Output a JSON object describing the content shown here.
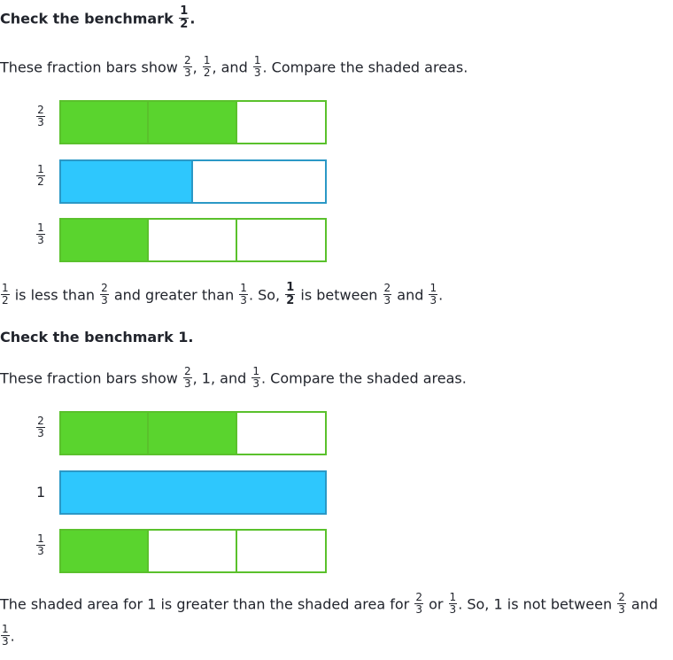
{
  "section1": {
    "heading_text": "Check the benchmark",
    "heading_frac": {
      "num": "1",
      "den": "2"
    },
    "intro": {
      "prefix": "These fraction bars show",
      "f1": {
        "num": "2",
        "den": "3"
      },
      "f2": {
        "num": "1",
        "den": "2"
      },
      "and": ", and",
      "f3": {
        "num": "1",
        "den": "3"
      },
      "suffix": ". Compare the shaded areas."
    },
    "bars": [
      {
        "label": {
          "num": "2",
          "den": "3"
        },
        "segments": 3,
        "filled": 2,
        "color": "#5ad42e"
      },
      {
        "label": {
          "num": "1",
          "den": "2"
        },
        "segments": 2,
        "filled": 1,
        "color": "#2ec7fd"
      },
      {
        "label": {
          "num": "1",
          "den": "3"
        },
        "segments": 3,
        "filled": 1,
        "color": "#5ad42e"
      }
    ],
    "conclusion": {
      "f_a": {
        "num": "1",
        "den": "2"
      },
      "t1": "is less than",
      "f_b": {
        "num": "2",
        "den": "3"
      },
      "t2": "and greater than",
      "f_c": {
        "num": "1",
        "den": "3"
      },
      "t3": ". So,",
      "f_d": {
        "num": "1",
        "den": "2"
      },
      "t4": "is between",
      "f_e": {
        "num": "2",
        "den": "3"
      },
      "t5": "and",
      "f_f": {
        "num": "1",
        "den": "3"
      },
      "t6": "."
    }
  },
  "section2": {
    "heading_text": "Check the benchmark 1.",
    "intro": {
      "prefix": "These fraction bars show",
      "f1": {
        "num": "2",
        "den": "3"
      },
      "mid": ", 1, and",
      "f3": {
        "num": "1",
        "den": "3"
      },
      "suffix": ". Compare the shaded areas."
    },
    "bars": [
      {
        "label": {
          "num": "2",
          "den": "3"
        },
        "segments": 3,
        "filled": 2,
        "color": "#5ad42e"
      },
      {
        "label_text": "1",
        "segments": 1,
        "filled": 1,
        "color": "#2ec7fd"
      },
      {
        "label": {
          "num": "1",
          "den": "3"
        },
        "segments": 3,
        "filled": 1,
        "color": "#5ad42e"
      }
    ],
    "conclusion": {
      "t1": "The shaded area for 1 is greater than the shaded area for",
      "f_a": {
        "num": "2",
        "den": "3"
      },
      "t2": "or",
      "f_b": {
        "num": "1",
        "den": "3"
      },
      "t3": ". So, 1 is not between",
      "f_c": {
        "num": "2",
        "den": "3"
      },
      "t4": "and",
      "f_d": {
        "num": "1",
        "den": "3"
      },
      "t5": "."
    }
  }
}
